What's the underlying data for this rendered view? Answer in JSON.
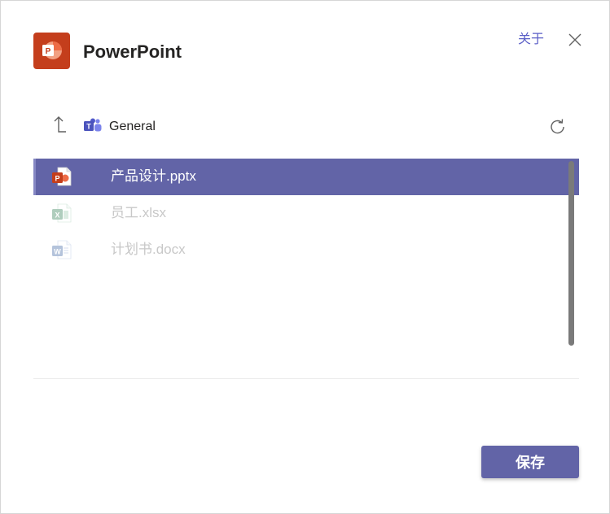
{
  "header": {
    "app_name": "PowerPoint",
    "app_icon": "powerpoint-icon",
    "about_label": "关于",
    "close_icon": "close-icon"
  },
  "nav": {
    "up_icon": "arrow-up-icon",
    "location_icon": "teams-icon",
    "breadcrumb": "General",
    "refresh_icon": "refresh-icon"
  },
  "files": [
    {
      "name": "产品设计.pptx",
      "icon": "powerpoint-file-icon",
      "selected": true,
      "enabled": true
    },
    {
      "name": "员工.xlsx",
      "icon": "excel-file-icon",
      "selected": false,
      "enabled": false
    },
    {
      "name": "计划书.docx",
      "icon": "word-file-icon",
      "selected": false,
      "enabled": false
    }
  ],
  "footer": {
    "save_label": "保存"
  },
  "colors": {
    "accent": "#6264a7",
    "powerpoint": "#c43e1c",
    "excel": "#1e7145",
    "word": "#2b579a",
    "link": "#5b5fc7"
  }
}
